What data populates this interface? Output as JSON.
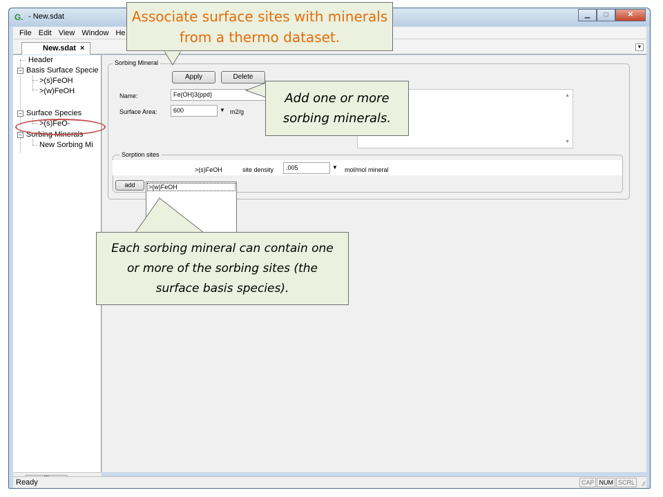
{
  "window": {
    "title": "- New.sdat",
    "app_icon": "G.",
    "controls": [
      "minimize",
      "maximize",
      "close"
    ]
  },
  "menu": [
    "File",
    "Edit",
    "View",
    "Window",
    "He"
  ],
  "tab": {
    "label": "New.sdat",
    "close": "×"
  },
  "tree": {
    "header": "Header",
    "basis": "Basis Surface Specie",
    "basis_children": [
      ">(s)FeOH",
      ">(w)FeOH"
    ],
    "surface": "Surface Species",
    "surface_children": [
      ">(s)FeO-"
    ],
    "sorbing": "Sorbing Minerals",
    "sorbing_children": [
      "New Sorbing Mi"
    ]
  },
  "sorbing_mineral": {
    "legend": "Sorbing Mineral",
    "apply": "Apply",
    "delete": "Delete",
    "name_label": "Name:",
    "name_value": "Fe(OH)3(ppd)",
    "area_label": "Surface Area:",
    "area_value": "600",
    "area_unit": "m2/g"
  },
  "sorption_sites": {
    "legend": "Sorption sites",
    "site_name": ">(s)FeOH",
    "density_label": "site density",
    "density_value": ".005",
    "density_unit": "mol/mol mineral",
    "add": "add",
    "combo_option": ">(w)FeOH"
  },
  "status": {
    "text": "Ready",
    "indicators": [
      "CAP",
      "NUM",
      "SCRL"
    ]
  },
  "callouts": {
    "top": "Associate surface sites with minerals from a thermo dataset.",
    "right": "Add one or more sorbing minerals.",
    "bottom": "Each sorbing mineral can contain one or more of the sorbing sites (the surface basis species)."
  },
  "colors": {
    "callout_bg": "#ebf1de",
    "callout_top_text": "#e36c0a",
    "highlight_ellipse": "#c0504d"
  }
}
